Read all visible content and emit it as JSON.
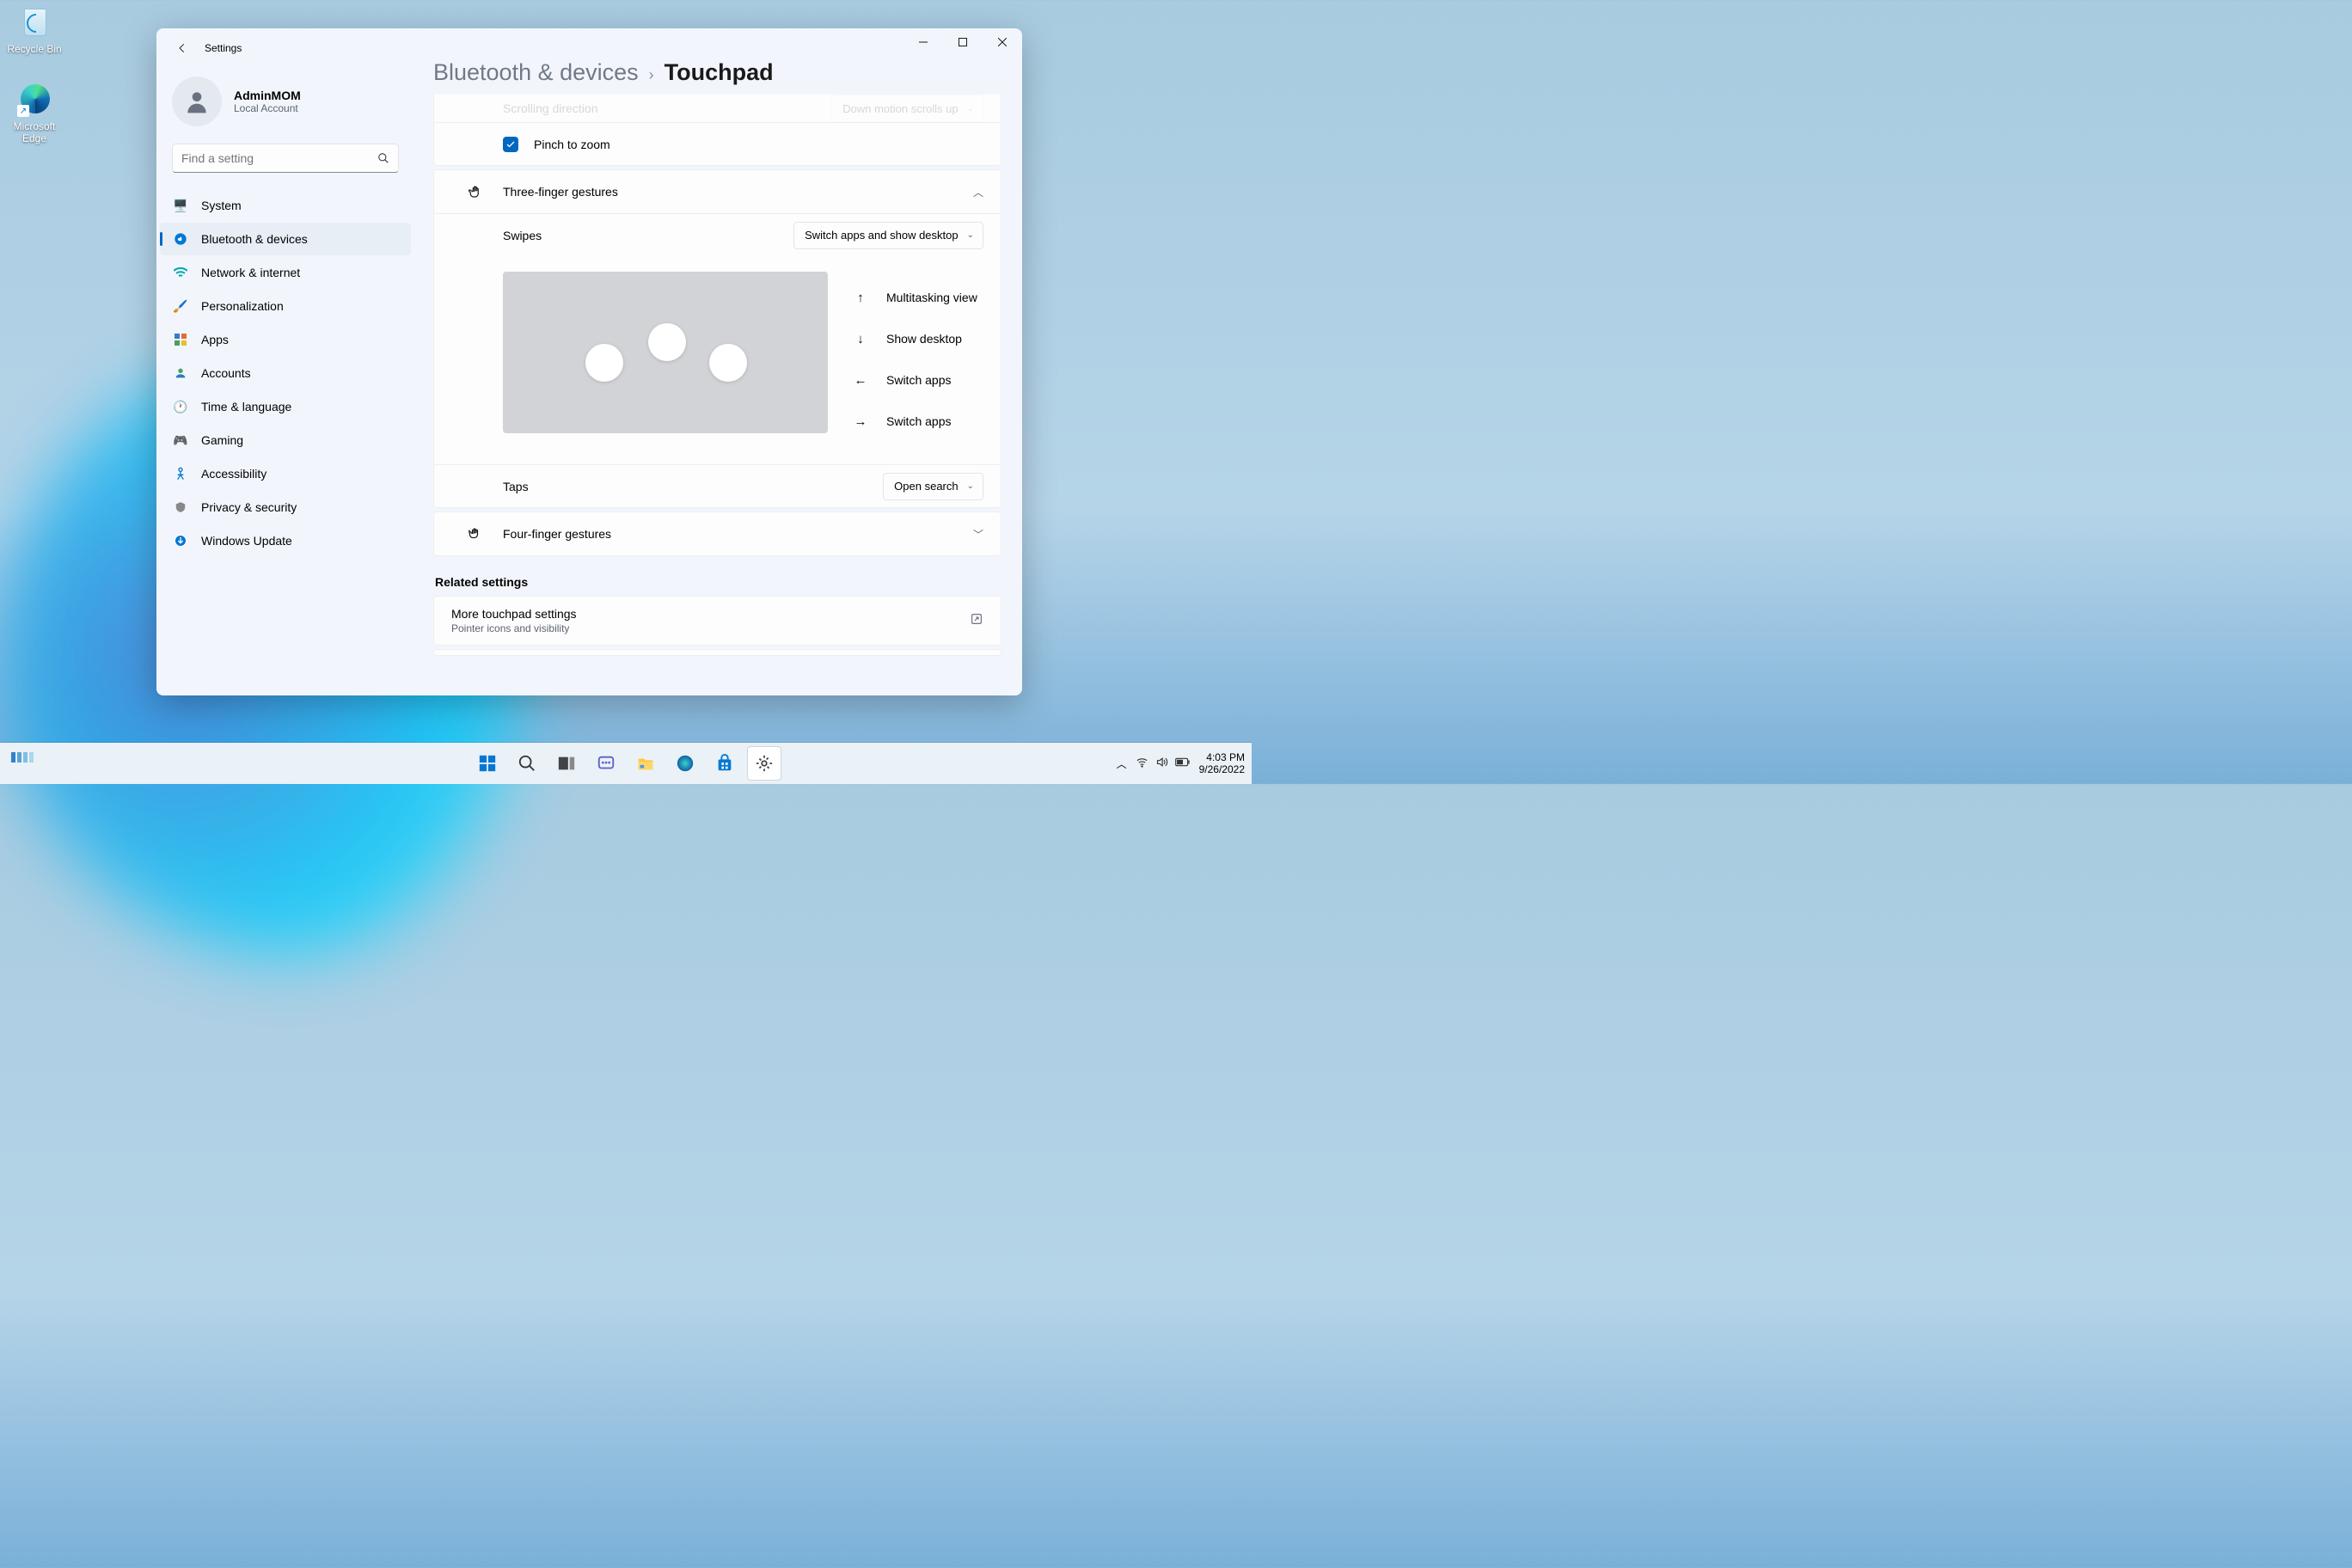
{
  "desktop": {
    "recycle_bin": "Recycle Bin",
    "edge": "Microsoft Edge"
  },
  "window": {
    "title": "Settings",
    "user_name": "AdminMOM",
    "user_sub": "Local Account",
    "search_placeholder": "Find a setting",
    "nav": [
      "System",
      "Bluetooth & devices",
      "Network & internet",
      "Personalization",
      "Apps",
      "Accounts",
      "Time & language",
      "Gaming",
      "Accessibility",
      "Privacy & security",
      "Windows Update"
    ],
    "nav_active_index": 1
  },
  "breadcrumb": {
    "parent": "Bluetooth & devices",
    "current": "Touchpad"
  },
  "scrolling_direction_label": "Scrolling direction",
  "scrolling_direction_value": "Down motion scrolls up",
  "pinch_zoom": "Pinch to zoom",
  "three_finger": {
    "header": "Three-finger gestures",
    "swipes_label": "Swipes",
    "swipes_value": "Switch apps and show desktop",
    "dir_up": "Multitasking view",
    "dir_down": "Show desktop",
    "dir_left": "Switch apps",
    "dir_right": "Switch apps",
    "taps_label": "Taps",
    "taps_value": "Open search"
  },
  "four_finger": "Four-finger gestures",
  "related_head": "Related settings",
  "related": {
    "title": "More touchpad settings",
    "sub": "Pointer icons and visibility"
  },
  "tray": {
    "time": "4:03 PM",
    "date": "9/26/2022"
  }
}
